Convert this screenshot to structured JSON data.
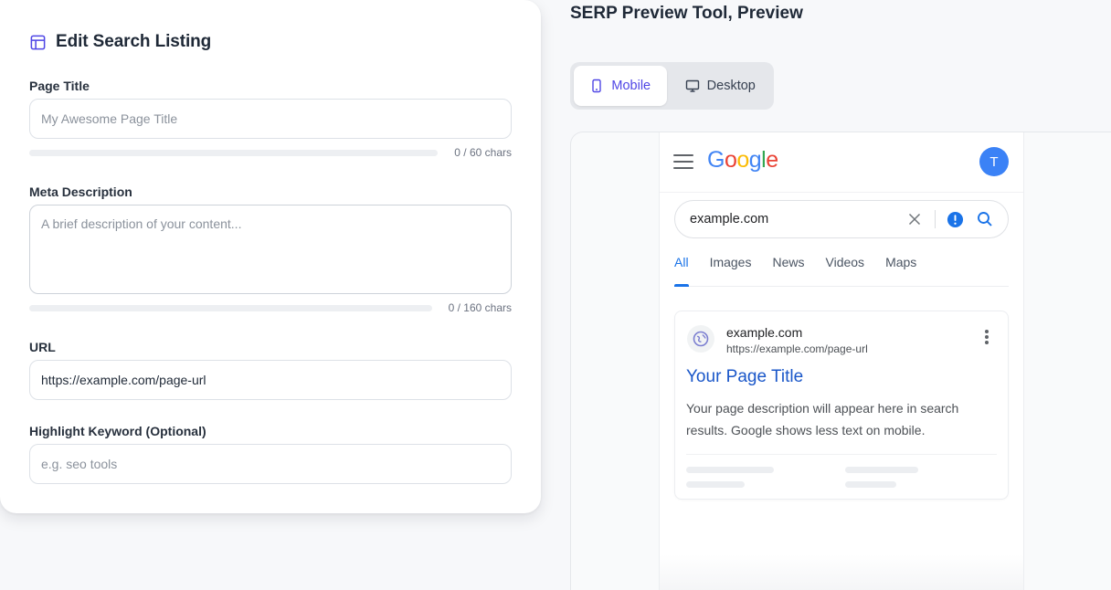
{
  "editor": {
    "title": "Edit Search Listing",
    "icon": "layout-icon",
    "page_title": {
      "label": "Page Title",
      "value": "",
      "placeholder": "My Awesome Page Title",
      "count": "0 / 60 chars",
      "progress": 0
    },
    "meta_description": {
      "label": "Meta Description",
      "value": "",
      "placeholder": "A brief description of your content...",
      "count": "0 / 160 chars",
      "progress": 0
    },
    "url": {
      "label": "URL",
      "value": "https://example.com/page-url"
    },
    "keyword": {
      "label": "Highlight Keyword (Optional)",
      "value": "",
      "placeholder": "e.g. seo tools"
    }
  },
  "preview": {
    "heading": "SERP Preview Tool, Preview",
    "toggle": {
      "mobile_label": "Mobile",
      "desktop_label": "Desktop",
      "selected": "Mobile"
    }
  },
  "google": {
    "logo_letters": [
      "G",
      "o",
      "o",
      "g",
      "l",
      "e"
    ],
    "logo_colors": [
      "#4285F4",
      "#EA4335",
      "#FBBC05",
      "#4285F4",
      "#34A853",
      "#EA4335"
    ],
    "avatar_initial": "T",
    "avatar_color": "#3b82f6",
    "search_query": "example.com",
    "tabs": [
      "All",
      "Images",
      "News",
      "Videos",
      "Maps"
    ],
    "active_tab": "All",
    "result": {
      "site_name": "example.com",
      "site_url": "https://example.com/page-url",
      "title": "Your Page Title",
      "description": "Your page description will appear here in search results. Google shows less text on mobile."
    }
  },
  "colors": {
    "accent": "#4f46e5",
    "google_blue": "#1a73e8",
    "link_blue": "#1a57c9"
  }
}
